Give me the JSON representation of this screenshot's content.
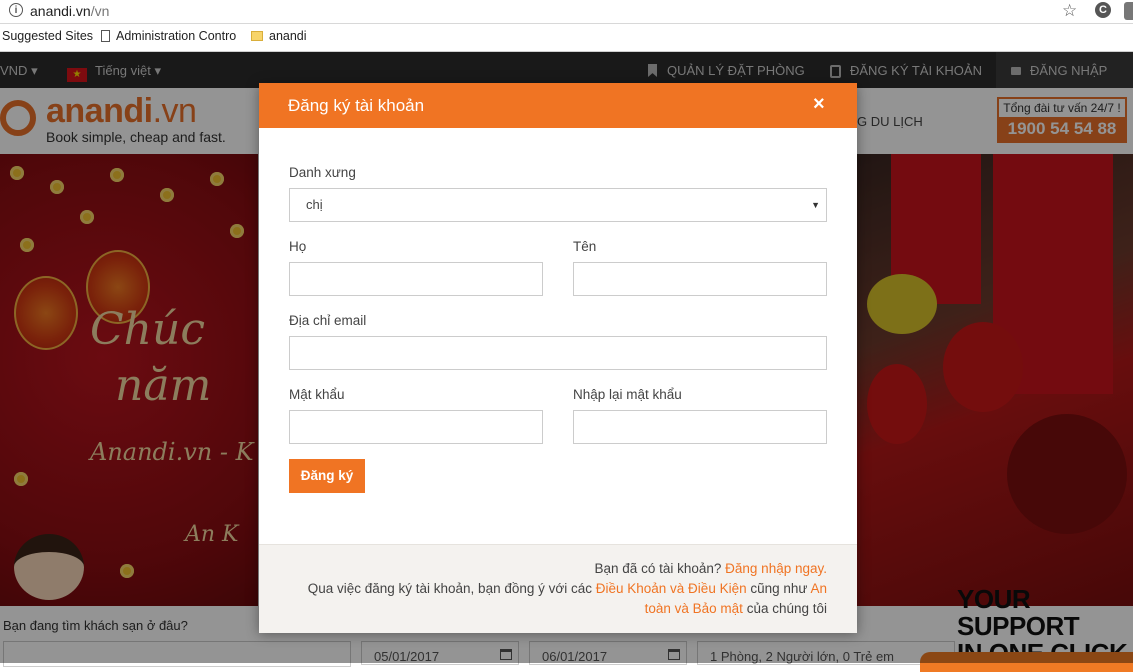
{
  "browser": {
    "url_host": "anandi.vn",
    "url_path": "/vn",
    "bookmarks": [
      "Suggested Sites",
      "Administration Contro",
      "anandi"
    ]
  },
  "topnav": {
    "currency": "VND",
    "language": "Tiếng việt",
    "manage_booking": "QUẢN LÝ ĐẶT PHÒNG",
    "register": "ĐĂNG KÝ TÀI KHOẢN",
    "login": "ĐĂNG NHẬP"
  },
  "header": {
    "logo_main": "anandi",
    "logo_domain": ".vn",
    "logo_tagline": "Book simple, cheap and fast.",
    "nav_partial": "G DU LỊCH",
    "hotline_label": "Tổng đài tư vấn 24/7 !",
    "hotline_number": "1900 54 54 88"
  },
  "banner": {
    "line1": "Chúc",
    "line2": "năm",
    "line3": "Anandi.vn - K",
    "line4": "An K",
    "support_line1": "YOUR SUPPORT",
    "support_line2": "IN ONE CLICK"
  },
  "search": {
    "label": "Bạn đang tìm khách sạn ở đâu?",
    "checkin": "05/01/2017",
    "checkout": "06/01/2017",
    "guests": "1 Phòng, 2 Người lớn, 0 Trẻ em"
  },
  "modal": {
    "title": "Đăng ký tài khoản",
    "salutation_label": "Danh xưng",
    "salutation_value": "chị",
    "lastname_label": "Họ",
    "firstname_label": "Tên",
    "email_label": "Địa chỉ email",
    "password_label": "Mật khẩu",
    "password_confirm_label": "Nhập lại mật khẩu",
    "submit_label": "Đăng ký",
    "footer": {
      "have_account": "Bạn đã có tài khoản?",
      "login_now": "Đăng nhập ngay.",
      "agree_prefix": "Qua việc đăng ký tài khoản, bạn đồng ý với các",
      "terms": "Điều Khoản và Điều Kiện",
      "agree_mid": "cũng như",
      "privacy_part1": "An",
      "privacy_part2": "toàn và Bảo mật",
      "agree_suffix": "của chúng tôi"
    }
  },
  "colors": {
    "brand_orange": "#f07423",
    "topnav_bg": "#2b2b2b"
  }
}
